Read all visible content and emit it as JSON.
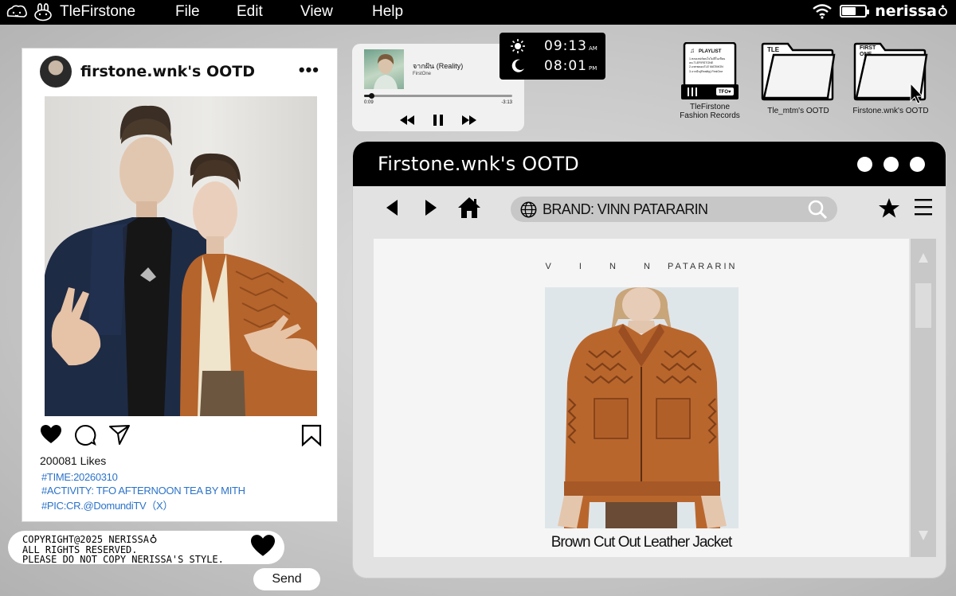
{
  "menubar": {
    "app_name": "TleFirstone",
    "menus": [
      "File",
      "Edit",
      "View",
      "Help"
    ],
    "user": "nerissa",
    "battery_level": 0.55
  },
  "post": {
    "username": "firstone.wnk's OOTD",
    "likes": "200081 Likes",
    "tags": [
      "#TIME:20260310",
      "#ACTIVITY: TFO AFTERNOON TEA BY MITH",
      "#PIC:CR.@DomundiTV（X）"
    ]
  },
  "copyright": {
    "lines": [
      "COPYRIGHT@2025 NERISSA",
      "ALL RIGHTS RESERVED.",
      "PLEASE DO NOT COPY NERISSA'S STYLE."
    ]
  },
  "send_label": "Send",
  "player": {
    "title": "จากฝัน (Reality)",
    "artist": "FirstOne",
    "elapsed": "0:09",
    "remaining": "-3:13",
    "progress": 0.05
  },
  "clock": {
    "day_time": "09:13",
    "day_suffix": "AM",
    "night_time": "08:01",
    "night_suffix": "PM"
  },
  "desktop_icons": [
    {
      "label": "TleFirstone\nFashion Records",
      "screen_title": "PLAYLIST",
      "screen_lines": [
        "1.หลงเสน่ห์คนใจไม่ดีในเขียนลด.TLEFIRSTONE",
        "2.แพรพลอยTLE MATIMON",
        "3.จากฝัน(Reality)-FirstOne"
      ],
      "badge": "TFO♥"
    },
    {
      "label": "Tle_mtm's OOTD",
      "tab": "TLE"
    },
    {
      "label": "Firstone.wnk's OOTD",
      "tab": "FIRST ONE"
    }
  ],
  "browser": {
    "title": "Firstone.wnk's OOTD",
    "address": "BRAND:  VINN PATARARIN",
    "brand_header_a": "V I N N",
    "brand_header_b": "PATARARIN",
    "product_name": "Brown Cut Out Leather Jacket"
  }
}
